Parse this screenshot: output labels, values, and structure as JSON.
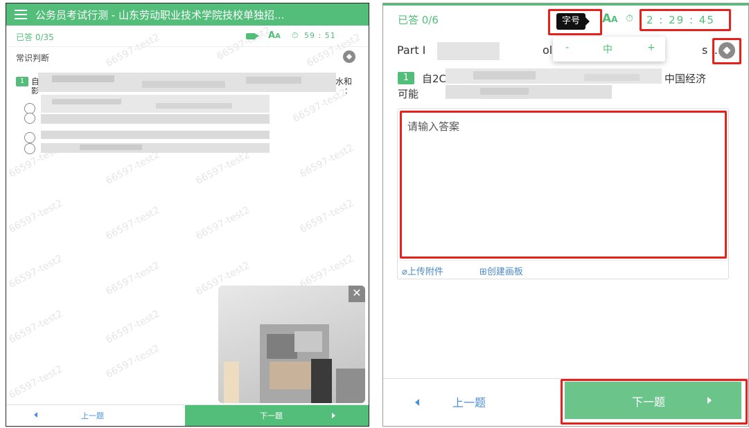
{
  "left": {
    "header": {
      "title": "公务员考试行测 - 山东劳动职业技术学院技校单独招..."
    },
    "status": {
      "answered": "已答 0/35",
      "font_icon_label": "A",
      "font_icon_sub": "A",
      "timer": "59 : 51",
      "clock_glyph": "⏱"
    },
    "section": {
      "title": "常识判断"
    },
    "question": {
      "number": "1",
      "visible_fragment_a": "自",
      "visible_fragment_b": "影",
      "visible_fragment_c": "水和",
      "visible_fragment_d": "："
    },
    "footer": {
      "prev_label": "上一题",
      "next_label": "下一题"
    },
    "camera": {
      "close_glyph": "✕"
    },
    "watermark": "66597-test2"
  },
  "right": {
    "status": {
      "answered": "已答 0/6",
      "tooltip": "字号",
      "font_icon_label": "A",
      "font_icon_sub": "A",
      "clock_glyph": "⏱",
      "timer": "2 : 29 : 45"
    },
    "part": {
      "prefix": "Part I",
      "middle": "oll",
      "suffix": "s i..."
    },
    "font_popup": {
      "minus": "-",
      "value": "中",
      "plus": "+"
    },
    "question": {
      "number": "1",
      "line1_start": "自2C",
      "line1_end": "中国经济",
      "line2": "可能"
    },
    "answer": {
      "placeholder": "请输入答案"
    },
    "actions": {
      "upload": "上传附件",
      "board": "创建画板",
      "upload_glyph": "⌀",
      "board_glyph": "⊞"
    },
    "footer": {
      "prev_label": "上一题",
      "next_label": "下一题"
    }
  },
  "colors": {
    "accent": "#52be7a",
    "link": "#4a90e2",
    "highlight": "#e8201c"
  }
}
